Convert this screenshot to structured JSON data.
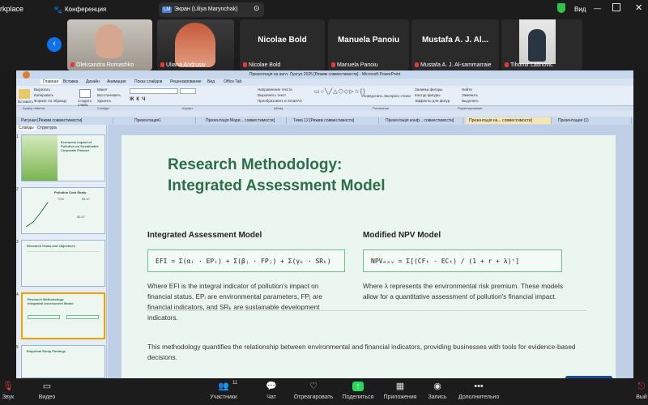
{
  "app": {
    "name_fragment": "rkplace",
    "meeting_label": "Конференция"
  },
  "share": {
    "badge": "LM",
    "label": "Экран (Liliya Marynchak)",
    "view_label": "Вид"
  },
  "participants": [
    {
      "name": "Oleksandra Romashko",
      "type": "video"
    },
    {
      "name": "Uliana Andrusiv",
      "type": "video"
    },
    {
      "name": "Nicolae Bold",
      "type": "name",
      "big": "Nicolae Bold"
    },
    {
      "name": "Manuela Panoiu",
      "type": "name",
      "big": "Manuela Panoiu"
    },
    {
      "name": "Mustafa A. J. Al-sammarraie",
      "type": "name",
      "big": "Mustafa A. J. Al..."
    },
    {
      "name": "Tihomir Latinovic",
      "type": "video"
    }
  ],
  "ppt": {
    "window_title": "Презентація на англ. Лунгул 2025 [Режим совместимости] - Microsoft PowerPoint",
    "ribbon_tabs": [
      "Главная",
      "Вставка",
      "Дизайн",
      "Анимация",
      "Показ слайдов",
      "Рецензирование",
      "Вид",
      "Office Tab"
    ],
    "ribbon_items": [
      "Вставить",
      "Вырезать",
      "Копировать",
      "Формат по образцу",
      "Создать слайд",
      "Макет",
      "Восстановить",
      "Удалить",
      "Направление текста",
      "Выровнять текст",
      "Преобразовать в SmartArt",
      "Упорядочить",
      "Экспресс-стили",
      "Заливка фигуры",
      "Контур фигуры",
      "Эффекты для фигур",
      "Найти",
      "Заменить",
      "Выделить"
    ],
    "ribbon_groups": [
      "Буфер обмена",
      "Слайды",
      "Шрифт",
      "Абзац",
      "Рисование",
      "Редактирование"
    ],
    "doc_tabs": [
      "Рисунки [Режим совместимости]",
      "Презентация1",
      "Презентація Мари... совместимости]",
      "Тема 12 [Режим совместимости]",
      "Презентація конф... совместимости]",
      "Презентація на... совместимости]",
      "Презентация (1)"
    ],
    "active_doc_tab": 5,
    "side_tabs": [
      "Слайды",
      "Структура"
    ],
    "thumbnails": [
      {
        "num": "1",
        "title": "Economic Impact of Pollution on Sustainable Corporate Finance"
      },
      {
        "num": "2",
        "title": "Pollution Cost Study",
        "v1": "70%",
        "v2": "$4.67",
        "v3": "$4.67"
      },
      {
        "num": "3",
        "title": "Research Goals and Objectives"
      },
      {
        "num": "4",
        "title": "Research Methodology: Integrated Assessment Model"
      },
      {
        "num": "5",
        "title": "Empirical Study Findings"
      }
    ]
  },
  "slide": {
    "title_line1": "Research Methodology:",
    "title_line2": "Integrated Assessment Model",
    "left_heading": "Integrated Assessment Model",
    "left_formula": "EFI = Σ(αᵢ · EPᵢ) + Σ(βⱼ · FPⱼ) + Σ(γₖ · SRₖ)",
    "left_text": "Where EFI is the integral indicator of pollution's impact on financial status, EPᵢ are environmental parameters, FPⱼ are financial indicators, and SRₖ are sustainable development indicators.",
    "right_heading": "Modified NPV Model",
    "right_formula": "NPVₘₒᵥ = Σ[(CFₜ - ECₜ) / (1 + r + λ)ᵗ]",
    "right_text": "Where λ represents the environmental risk premium. These models allow for a quantitative assessment of pollution's financial impact.",
    "bottom_text": "This methodology quantifies the relationship between environmental and financial indicators, providing businesses with tools for evidence-based decisions."
  },
  "toolbar": {
    "audio": "Звук",
    "video": "Видео",
    "participants": "Участники",
    "participants_count": "11",
    "chat": "Чат",
    "react": "Отреагировать",
    "share": "Поделиться",
    "apps": "Приложения",
    "record": "Запись",
    "more": "Дополнительно",
    "leave": "Вый"
  },
  "colors": {
    "accent": "#0e72ed",
    "slide_title": "#2b6e49",
    "share_green": "#23d959",
    "mic_off": "#e23b3b"
  }
}
